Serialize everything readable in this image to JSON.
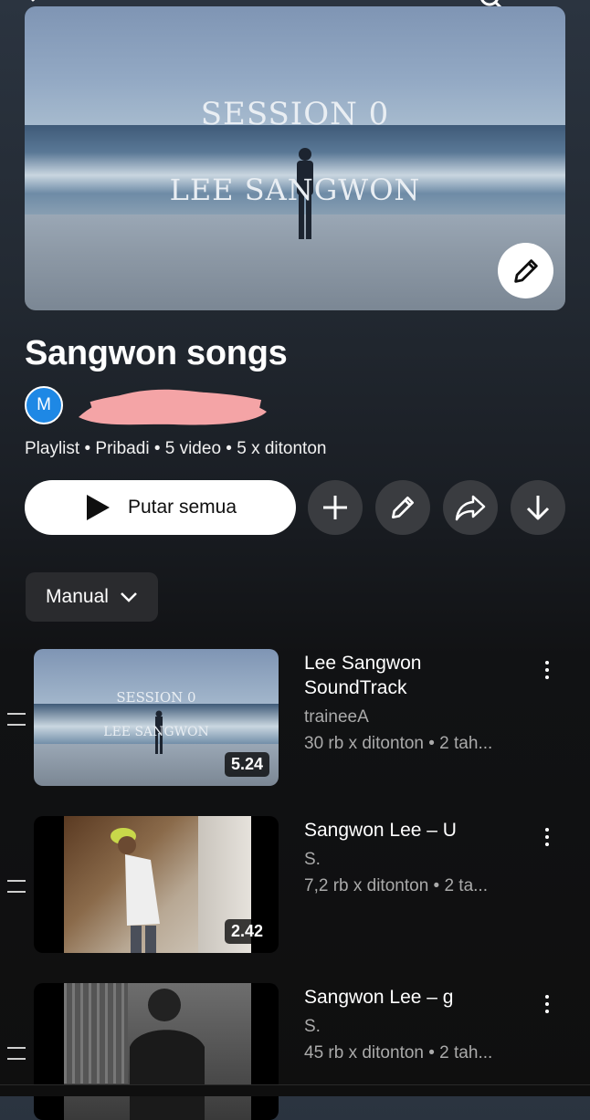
{
  "cover": {
    "line1": "SESSION 0",
    "line2": "LEE SANGWON"
  },
  "playlist": {
    "title": "Sangwon songs",
    "owner_initial": "M",
    "meta": "Playlist • Pribadi • 5 video • 5 x ditonton"
  },
  "actions": {
    "play_all": "Putar semua",
    "icons": [
      "add-icon",
      "edit-icon",
      "share-icon",
      "download-icon"
    ]
  },
  "sort": {
    "label": "Manual"
  },
  "videos": [
    {
      "title_line1": "Lee Sangwon",
      "title_line2": "SoundTrack",
      "channel": "traineeA",
      "stats": "30 rb x ditonton • 2 tah...",
      "duration": "5.24",
      "thumb_line1": "SESSION 0",
      "thumb_line2": "LEE SANGWON"
    },
    {
      "title_line1": "Sangwon Lee – U",
      "channel": "S.",
      "stats": "7,2 rb x ditonton • 2 ta...",
      "duration": "2.42"
    },
    {
      "title_line1": "Sangwon Lee – g",
      "channel": "S.",
      "stats": "45 rb x ditonton • 2 tah..."
    }
  ],
  "colors": {
    "avatar": "#1e88e5",
    "redaction": "#f4a4a6"
  }
}
